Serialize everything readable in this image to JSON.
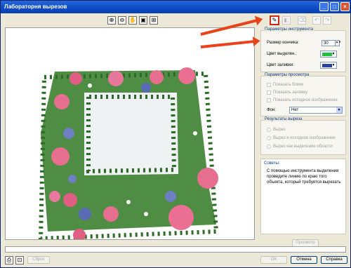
{
  "window": {
    "title": "Лабораторня вырезов",
    "minimize": "_",
    "maximize": "□",
    "close": "×"
  },
  "view_toolbar": {
    "zoom_in_icon": "zoom-in-icon",
    "zoom_out_icon": "zoom-out-icon",
    "hand_icon": "hand-icon",
    "fit_icon": "fit-window-icon",
    "actual_size_icon": "actual-size-icon"
  },
  "tool_toolbar": {
    "active_tool_icon": "highlight-brush-icon",
    "eraser_icon": "eraser-icon",
    "fill_icon": "fill-icon",
    "undo_icon": "undo-icon",
    "redo_icon": "redo-icon"
  },
  "tool_params": {
    "title": "Параметры инструмента",
    "brush_size_label": "Размер кончика:",
    "brush_size_value": "30",
    "highlight_color_label": "Цвет выделен.:",
    "highlight_color": "#1fbf3a",
    "fill_color_label": "Цвет заливки:",
    "fill_color": "#2b3f9e"
  },
  "preview_params": {
    "title": "Параметры просмотра",
    "show_highlight": "Показать блики",
    "show_fill": "Показать заливку",
    "show_original": "Показать исходное изображение",
    "background_label": "Фон:",
    "background_value": "Нет"
  },
  "cut_results": {
    "title": "Результаты выреза",
    "option1": "Вырез",
    "option2": "Вырез и исходное изображение",
    "option3": "Вырез как выделение области"
  },
  "tips": {
    "title": "Советы:",
    "text": "С помощью инструмента выделения проведите линию по краю того объекта, который требуется вырезать"
  },
  "preview_button": "Просмотр",
  "bottom_bar": {
    "reset_button": "Сброс",
    "ok_button": "OK",
    "cancel_button": "Отмена",
    "help_button": "Справка"
  },
  "colors": {
    "title_bar": "#0b4bc4",
    "annotation_arrow": "#e8431a",
    "rose": "#e66f8f",
    "leaf": "#3f7b3a"
  }
}
